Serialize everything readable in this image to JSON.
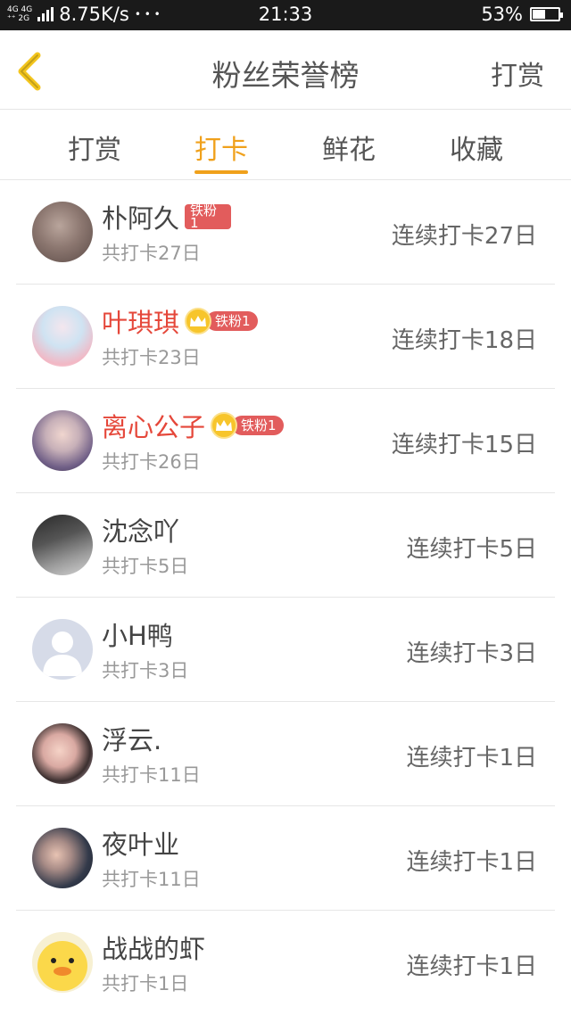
{
  "status_bar": {
    "network_top": "4G 4G",
    "network_bottom": "⁺⁺ 2G",
    "speed": "8.75K/s",
    "dots": "• • •",
    "time": "21:33",
    "battery": "53%",
    "battery_level": 0.53
  },
  "header": {
    "title": "粉丝荣誉榜",
    "action": "打赏"
  },
  "tabs": [
    {
      "label": "打赏",
      "active": false
    },
    {
      "label": "打卡",
      "active": true
    },
    {
      "label": "鲜花",
      "active": false
    },
    {
      "label": "收藏",
      "active": false
    }
  ],
  "accent_color": "#f0a11c",
  "rows": [
    {
      "name": "朴阿久",
      "highlight": false,
      "badge": "铁粉1",
      "badge_style": "wrapped",
      "badge_line1": "铁粉",
      "badge_line2": "1",
      "total": "共打卡27日",
      "streak": "连续打卡27日"
    },
    {
      "name": "叶琪琪",
      "highlight": true,
      "badge": "铁粉1",
      "badge_style": "crown",
      "total": "共打卡23日",
      "streak": "连续打卡18日"
    },
    {
      "name": "离心公子",
      "highlight": true,
      "badge": "铁粉1",
      "badge_style": "crown",
      "total": "共打卡26日",
      "streak": "连续打卡15日"
    },
    {
      "name": "沈念吖",
      "highlight": false,
      "badge": "",
      "total": "共打卡5日",
      "streak": "连续打卡5日"
    },
    {
      "name": "小H鸭",
      "highlight": false,
      "badge": "",
      "total": "共打卡3日",
      "streak": "连续打卡3日"
    },
    {
      "name": "浮云.",
      "highlight": false,
      "badge": "",
      "total": "共打卡11日",
      "streak": "连续打卡1日"
    },
    {
      "name": "夜叶业",
      "highlight": false,
      "badge": "",
      "total": "共打卡11日",
      "streak": "连续打卡1日"
    },
    {
      "name": "战战的虾",
      "highlight": false,
      "badge": "",
      "total": "共打卡1日",
      "streak": "连续打卡1日"
    }
  ]
}
